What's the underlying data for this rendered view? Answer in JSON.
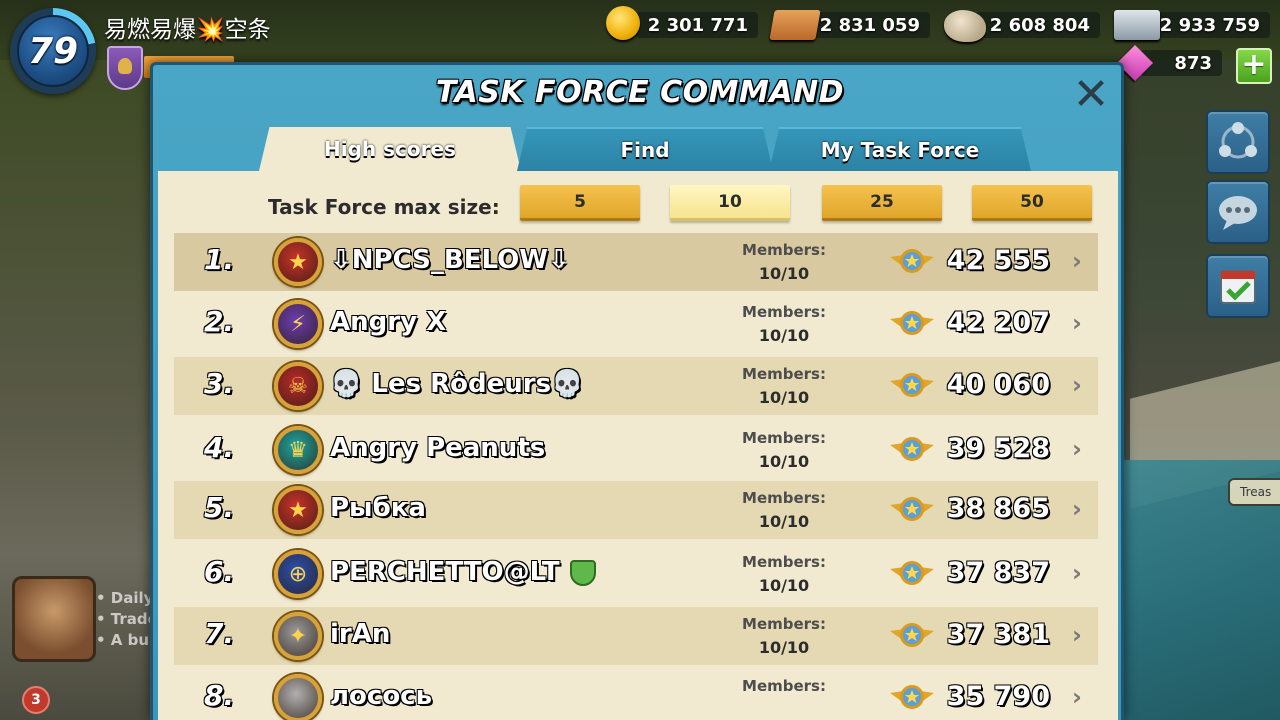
{
  "player": {
    "level": "79",
    "name": "易燃易爆💥空条"
  },
  "resources": {
    "gold": "2 301 771",
    "wood": "2 831 059",
    "stone": "2 608 804",
    "iron": "2 933 759",
    "diamonds": "873",
    "add_label": "+"
  },
  "panel": {
    "title": "TASK FORCE COMMAND",
    "close_label": "✕",
    "tabs": [
      {
        "label": "High scores",
        "active": true
      },
      {
        "label": "Find",
        "active": false
      },
      {
        "label": "My Task Force",
        "active": false
      }
    ],
    "max_size_label": "Task Force max size:",
    "size_options": [
      "5",
      "10",
      "25",
      "50"
    ],
    "selected_size": "10",
    "members_label": "Members:"
  },
  "rows": [
    {
      "rank": "1.",
      "name": "⇩NPCS_BELOW⇩",
      "members": "10/10",
      "score": "42 555",
      "emblem_color": "#c8322a",
      "emblem_glyph": "★"
    },
    {
      "rank": "2.",
      "name": "Angry X",
      "members": "10/10",
      "score": "42 207",
      "emblem_color": "#6a3db0",
      "emblem_glyph": "⚡"
    },
    {
      "rank": "3.",
      "name": "💀 Les Rôdeurs💀",
      "members": "10/10",
      "score": "40 060",
      "emblem_color": "#b82a2a",
      "emblem_glyph": "☠"
    },
    {
      "rank": "4.",
      "name": "Angry Peanuts",
      "members": "10/10",
      "score": "39 528",
      "emblem_color": "#1ea4a0",
      "emblem_glyph": "♛"
    },
    {
      "rank": "5.",
      "name": "Рыбка",
      "members": "10/10",
      "score": "38 865",
      "emblem_color": "#c8322a",
      "emblem_glyph": "★"
    },
    {
      "rank": "6.",
      "name": "PERCHETTO@LT",
      "members": "10/10",
      "score": "37 837",
      "emblem_color": "#2a4fb0",
      "emblem_glyph": "⊕"
    },
    {
      "rank": "7.",
      "name": "irAn",
      "members": "10/10",
      "score": "37 381",
      "emblem_color": "#9a9a9a",
      "emblem_glyph": "✦"
    },
    {
      "rank": "8.",
      "name": "лосось",
      "members": "",
      "score": "35 790",
      "emblem_color": "#b0b0b0",
      "emblem_glyph": ""
    }
  ],
  "side": {
    "advisor_lines": [
      "• Daily",
      "• Trade",
      "• A buil"
    ],
    "notification_count": "3",
    "map_label": "Treas"
  },
  "colors": {
    "panel_blue": "#4aa6c6",
    "parchment": "#f1ead0",
    "size_button": "#e0a62a"
  }
}
